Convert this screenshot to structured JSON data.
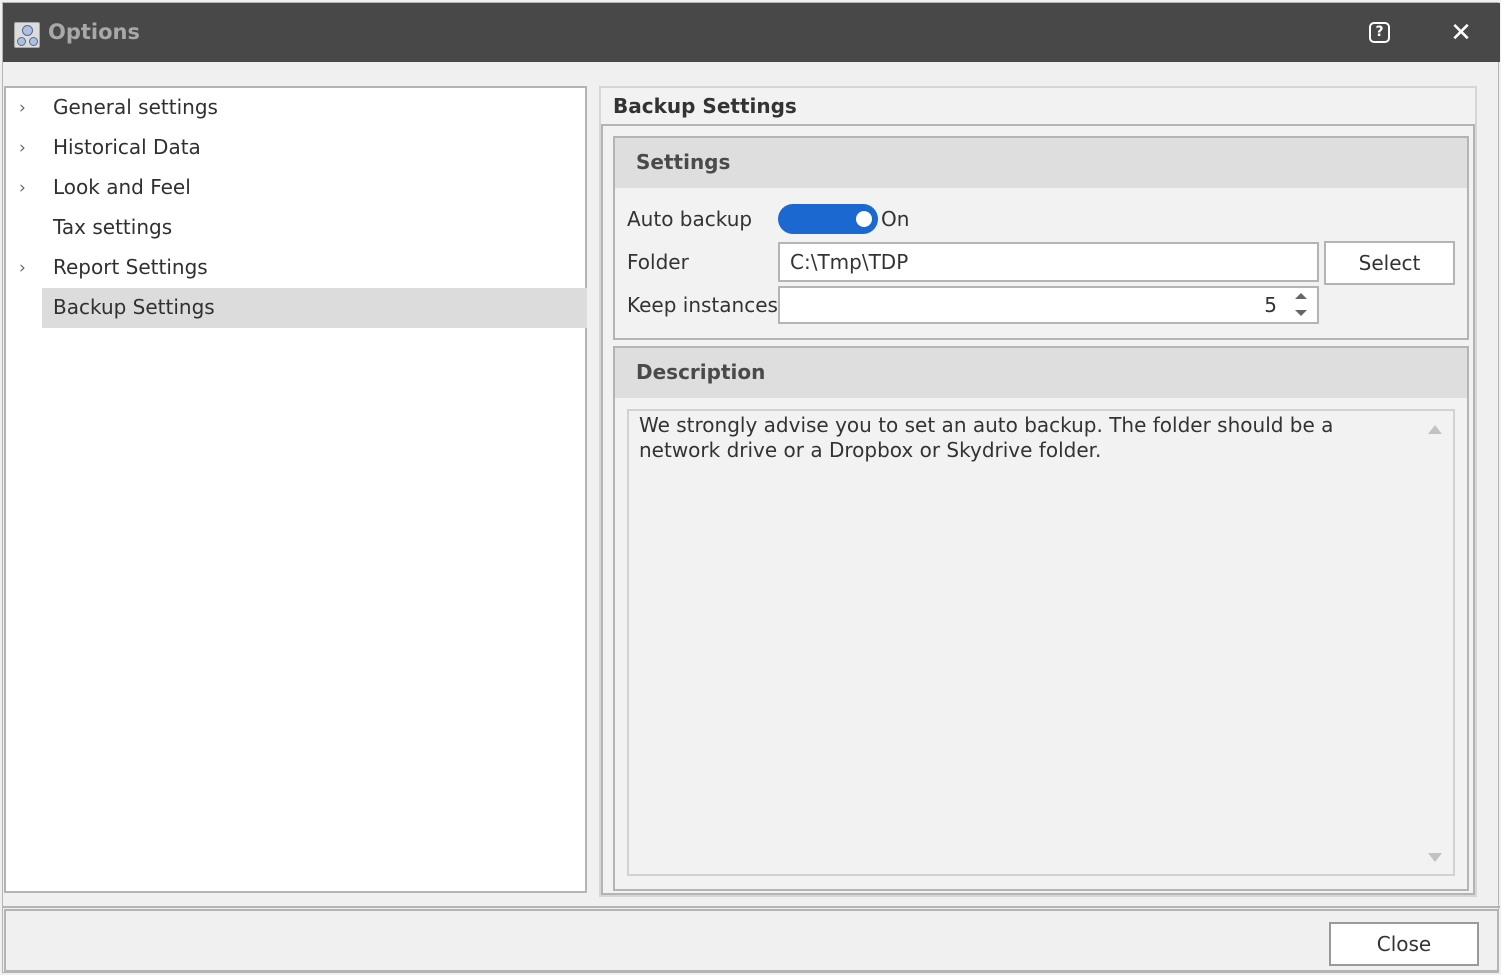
{
  "window": {
    "title": "Options",
    "app_icon": "gauges-icon",
    "help_icon": "?",
    "close_icon": "✕"
  },
  "tree": {
    "items": [
      {
        "label": "General settings",
        "expandable": true,
        "selected": false
      },
      {
        "label": "Historical Data",
        "expandable": true,
        "selected": false
      },
      {
        "label": "Look and Feel",
        "expandable": true,
        "selected": false
      },
      {
        "label": "Tax settings",
        "expandable": false,
        "selected": false
      },
      {
        "label": "Report Settings",
        "expandable": true,
        "selected": false
      },
      {
        "label": "Backup Settings",
        "expandable": false,
        "selected": true
      }
    ],
    "chevron": "›"
  },
  "panel": {
    "title": "Backup Settings",
    "settings_group": {
      "title": "Settings",
      "auto_backup_label": "Auto backup",
      "auto_backup_state": "On",
      "auto_backup_on": true,
      "folder_label": "Folder",
      "folder_value": "C:\\Tmp\\TDP",
      "select_button": "Select",
      "keep_instances_label": "Keep instances",
      "keep_instances_value": "5"
    },
    "description_group": {
      "title": "Description",
      "text": "We strongly advise you to set an auto backup. The folder should be a network drive or a Dropbox or Skydrive folder."
    }
  },
  "footer": {
    "close_button": "Close"
  },
  "colors": {
    "titlebar": "#484848",
    "toggle_on": "#1a68d0",
    "selected_row": "#dcdcdc"
  }
}
